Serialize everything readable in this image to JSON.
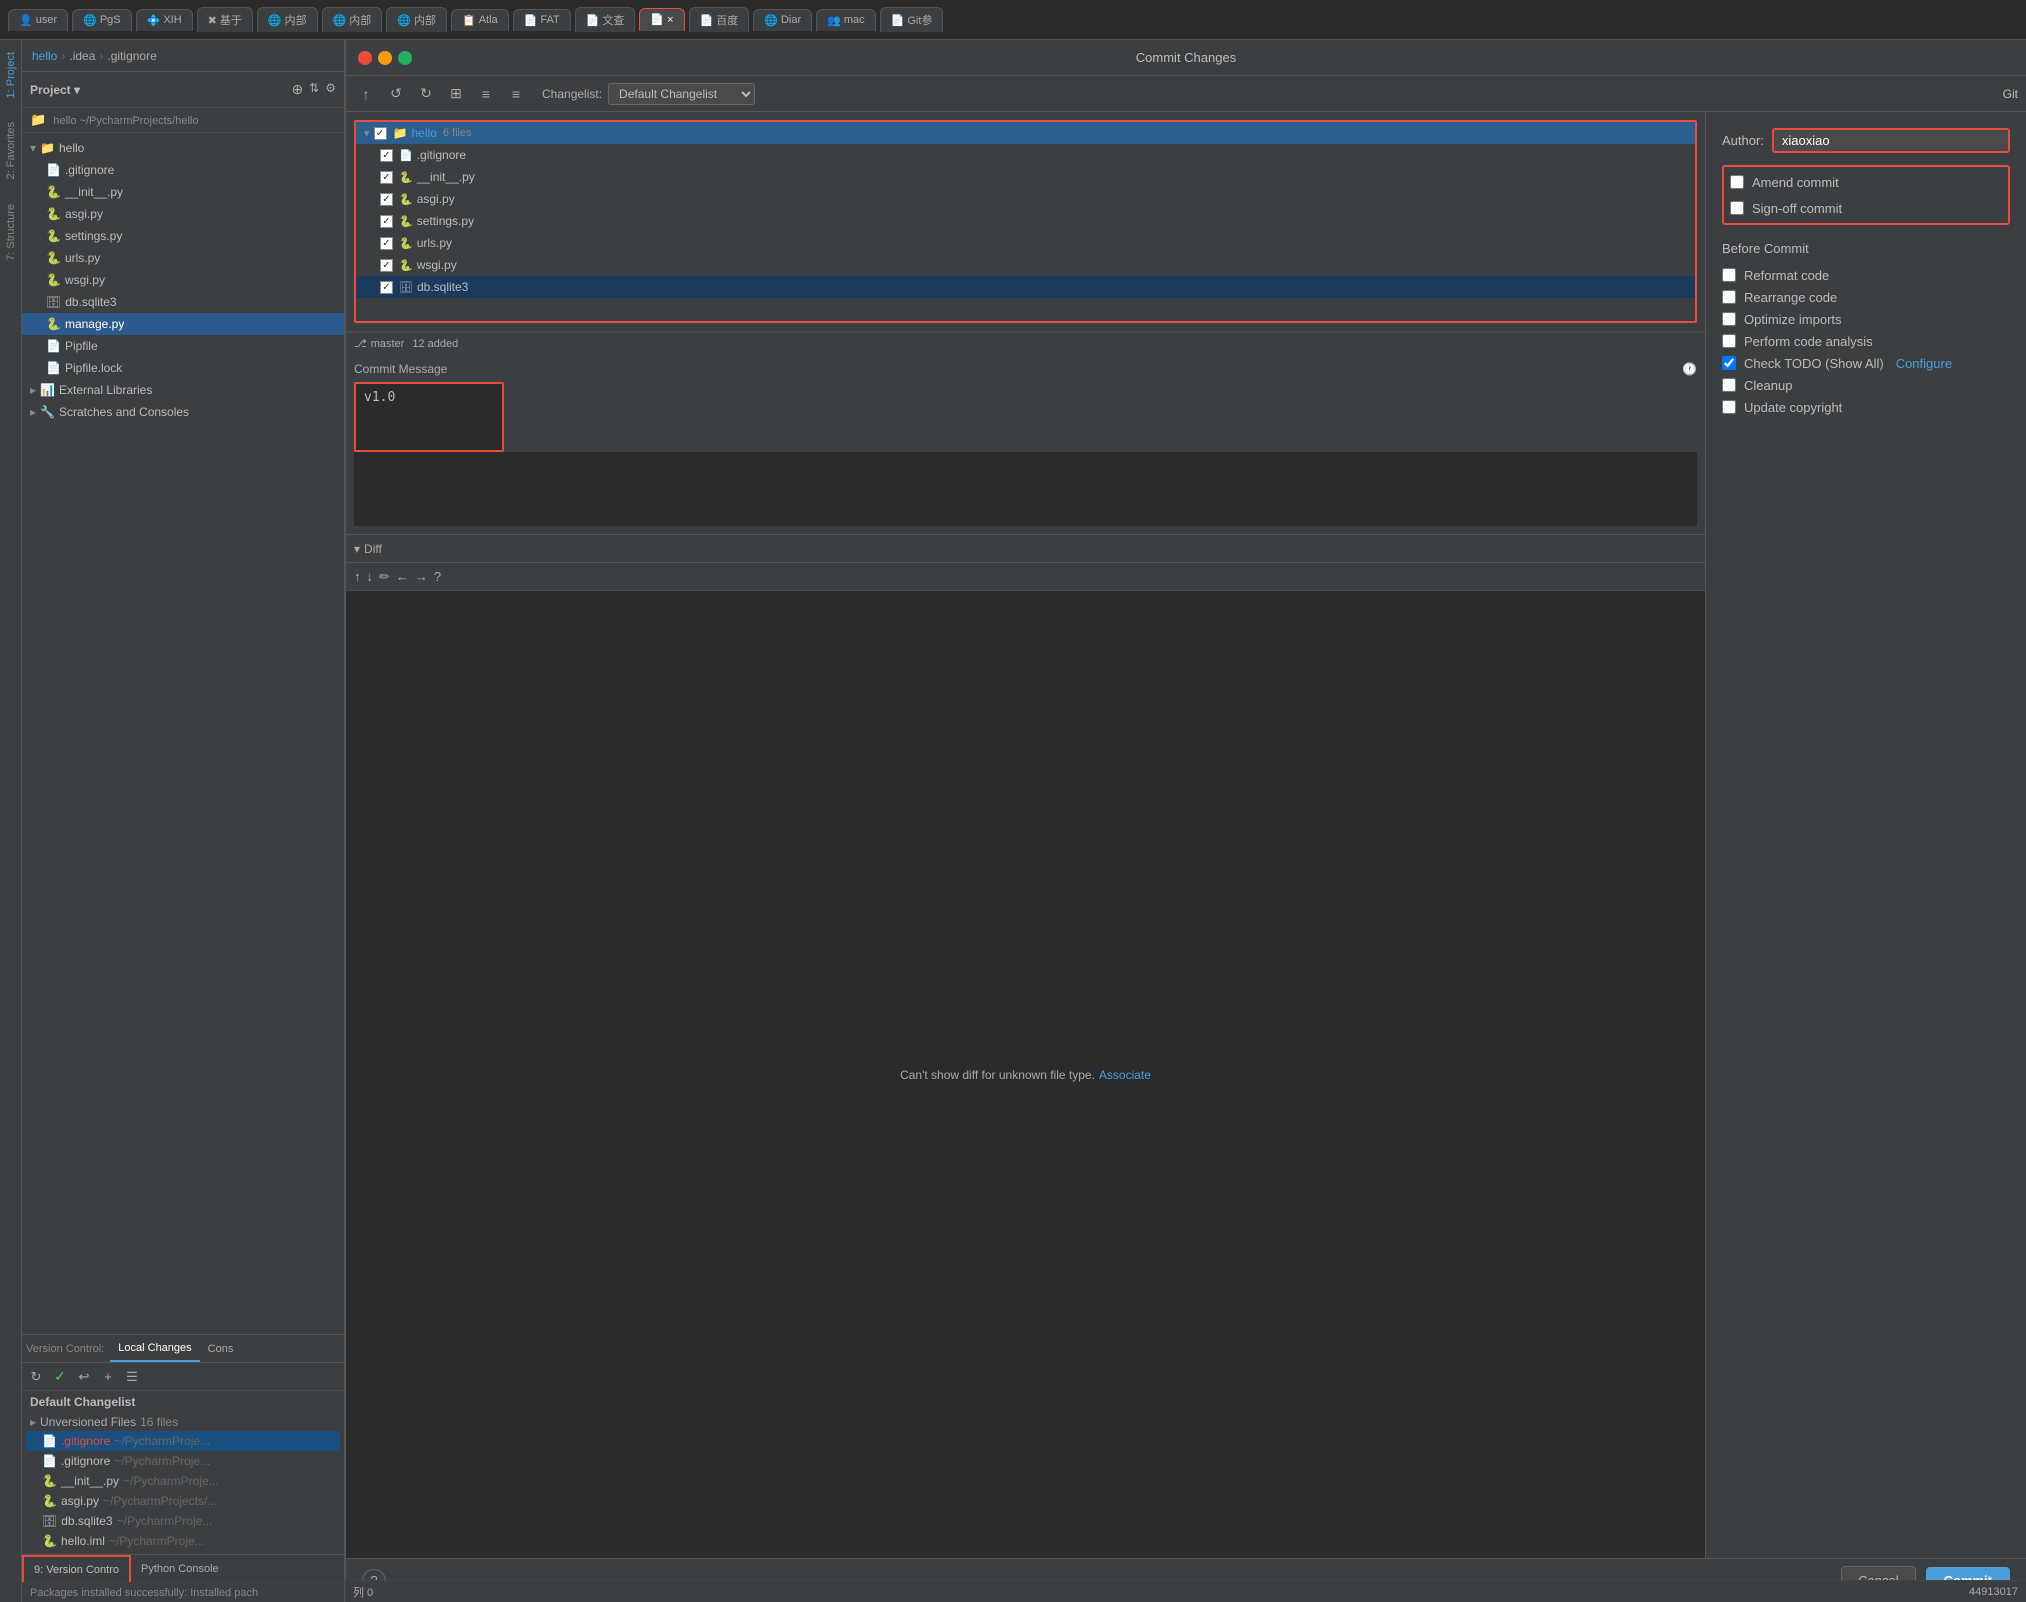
{
  "browser": {
    "tabs": [
      {
        "label": "user",
        "icon": "👤",
        "active": false
      },
      {
        "label": "PgS",
        "icon": "🌐",
        "active": false
      },
      {
        "label": "XIH",
        "icon": "💠",
        "active": false
      },
      {
        "label": "基于",
        "icon": "✖",
        "active": false
      },
      {
        "label": "内部",
        "icon": "🌐",
        "active": false
      },
      {
        "label": "内部",
        "icon": "🌐",
        "active": false
      },
      {
        "label": "内部",
        "icon": "🌐",
        "active": false
      },
      {
        "label": "Atla",
        "icon": "📋",
        "active": false
      },
      {
        "label": "FAT",
        "icon": "📄",
        "active": false
      },
      {
        "label": "文查",
        "icon": "📄",
        "active": false
      },
      {
        "label": "×",
        "icon": "📄",
        "active": true
      },
      {
        "label": "百度",
        "icon": "📄",
        "active": false
      },
      {
        "label": "Diar",
        "icon": "🌐",
        "active": false
      },
      {
        "label": "mac",
        "icon": "👥",
        "active": false
      },
      {
        "label": "Git参",
        "icon": "📄",
        "active": false
      }
    ]
  },
  "dialog": {
    "title": "Commit Changes",
    "window_controls": {
      "close": "close",
      "minimize": "minimize",
      "maximize": "maximize"
    },
    "toolbar": {
      "buttons": [
        "↑",
        "↺",
        "↻",
        "⊞",
        "≡↑",
        "≡↓"
      ],
      "changelist_label": "Changelist:",
      "changelist_value": "Default Changelist",
      "git_label": "Git"
    },
    "file_tree": {
      "root": "hello",
      "root_count": "6 files",
      "files": [
        {
          "name": ".gitignore",
          "checked": true
        },
        {
          "name": "__init__.py",
          "checked": true
        },
        {
          "name": "asgi.py",
          "checked": true
        },
        {
          "name": "settings.py",
          "checked": true
        },
        {
          "name": "urls.py",
          "checked": true
        },
        {
          "name": "wsgi.py",
          "checked": true
        },
        {
          "name": "db.sqlite3",
          "checked": true
        }
      ]
    },
    "status_bar": {
      "branch": "master",
      "count": "12 added"
    },
    "commit_message": {
      "label": "Commit Message",
      "value": "v1.0",
      "placeholder": "v1.0"
    },
    "right_panel": {
      "author_label": "Author:",
      "author_value": "xiaoxiao",
      "checkboxes": [
        {
          "id": "amend",
          "label": "Amend commit",
          "checked": false,
          "has_border": true
        },
        {
          "id": "signoff",
          "label": "Sign-off commit",
          "checked": false
        }
      ],
      "before_commit_label": "Before Commit",
      "before_commit_items": [
        {
          "id": "reformat",
          "label": "Reformat code",
          "checked": false
        },
        {
          "id": "rearrange",
          "label": "Rearrange code",
          "checked": false
        },
        {
          "id": "optimize",
          "label": "Optimize imports",
          "checked": false
        },
        {
          "id": "analyze",
          "label": "Perform code analysis",
          "checked": false
        },
        {
          "id": "todo",
          "label": "Check TODO (Show All)",
          "checked": true,
          "has_link": true,
          "link_text": "Configure"
        },
        {
          "id": "cleanup",
          "label": "Cleanup",
          "checked": false
        },
        {
          "id": "copyright",
          "label": "Update copyright",
          "checked": false
        }
      ]
    },
    "diff": {
      "title": "Diff",
      "message": "Can't show diff for unknown file type.",
      "associate_link": "Associate"
    },
    "footer": {
      "help": "?",
      "cancel": "Cancel",
      "commit": "Commit"
    }
  },
  "ide": {
    "breadcrumb": {
      "parts": [
        "hello",
        ".idea",
        ".gitignore"
      ]
    },
    "project_header": "Project ▾",
    "project_root": "hello ~/PycharmProjects/hello",
    "tree_items": [
      {
        "name": "hello",
        "type": "folder",
        "indent": 1
      },
      {
        "name": ".gitignore",
        "type": "file-git",
        "indent": 2
      },
      {
        "name": "__init__.py",
        "type": "file-py",
        "indent": 2
      },
      {
        "name": "asgi.py",
        "type": "file-py",
        "indent": 2
      },
      {
        "name": "settings.py",
        "type": "file-py",
        "indent": 2
      },
      {
        "name": "urls.py",
        "type": "file-py",
        "indent": 2
      },
      {
        "name": "wsgi.py",
        "type": "file-py",
        "indent": 2
      },
      {
        "name": "db.sqlite3",
        "type": "file-db",
        "indent": 2
      },
      {
        "name": "manage.py",
        "type": "file-py",
        "indent": 2,
        "selected": true
      },
      {
        "name": "Pipfile",
        "type": "file",
        "indent": 2
      },
      {
        "name": "Pipfile.lock",
        "type": "file",
        "indent": 2
      },
      {
        "name": "External Libraries",
        "type": "folder",
        "indent": 1
      },
      {
        "name": "Scratches and Consoles",
        "type": "scratch",
        "indent": 1
      }
    ],
    "bottom_panel": {
      "version_control_label": "Version Control:",
      "tabs": [
        {
          "label": "Local Changes",
          "active": true
        },
        {
          "label": "Cons",
          "active": false
        }
      ],
      "default_changelist": "Default Changelist",
      "unversioned_label": "Unversioned Files",
      "unversioned_count": "16 files",
      "files": [
        {
          "name": ".gitignore",
          "path": "~/PycharmProje...",
          "highlighted": true
        },
        {
          "name": ".gitignore",
          "path": "~/PycharmProje..."
        },
        {
          "name": "__init__.py",
          "path": "~/PycharmProje..."
        },
        {
          "name": "asgi.py",
          "path": "~/PycharmProjects/..."
        },
        {
          "name": "db.sqlite3",
          "path": "~/PycharmProje..."
        },
        {
          "name": "hello.iml",
          "path": "~/PycharmProje..."
        }
      ]
    },
    "bottom_bar": {
      "vc_tab": "9: Version Contro",
      "python_tab": "Python Console"
    },
    "status_message": "Packages installed successfully: Installed pach"
  },
  "vertical_tabs": {
    "left": [
      "1: Project",
      "2: Favorites",
      "7: Structure"
    ],
    "right": []
  },
  "status_bar": {
    "col": "列 0",
    "info": "44913017"
  }
}
